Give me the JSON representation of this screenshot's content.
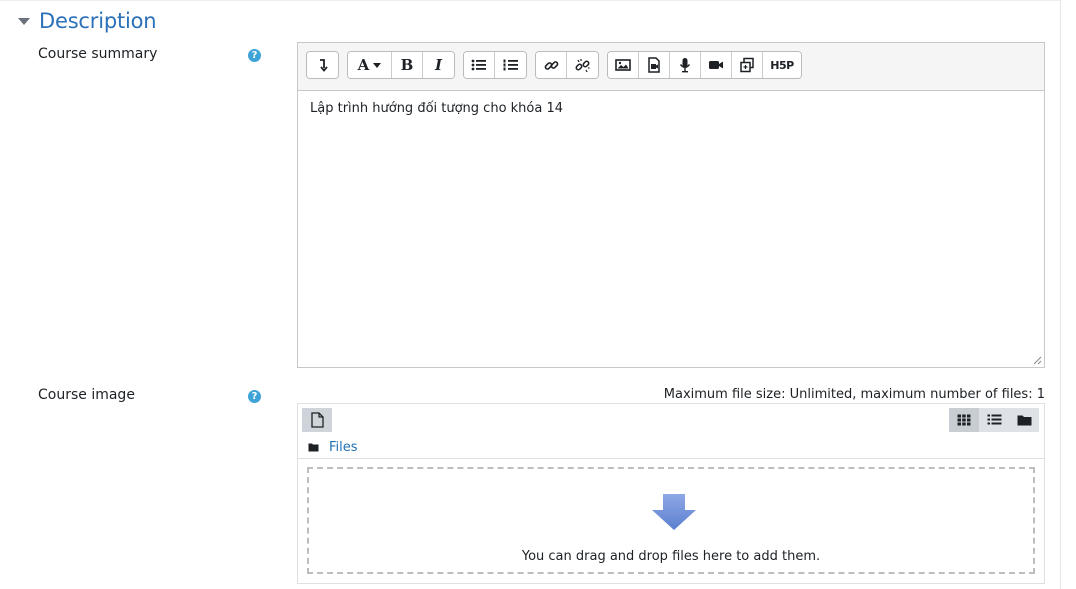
{
  "section": {
    "title": "Description",
    "collapse_icon": "caret-down-icon"
  },
  "summary": {
    "label": "Course summary",
    "help_icon": "question-circle-icon",
    "content": "Lập trình hướng đối tượng cho khóa 14",
    "toolbar": {
      "groups": [
        [
          "show-more-buttons"
        ],
        [
          "font-style",
          "bold",
          "italic"
        ],
        [
          "unordered-list",
          "ordered-list"
        ],
        [
          "link",
          "unlink"
        ],
        [
          "image",
          "media",
          "record-audio",
          "record-video",
          "manage-files",
          "h5p"
        ]
      ],
      "font_glyph": "A",
      "bold_glyph": "B",
      "italic_glyph": "I",
      "h5p_label": "H5P"
    }
  },
  "course_image": {
    "label": "Course image",
    "help_icon": "question-circle-icon",
    "max_size_text": "Maximum file size: Unlimited, maximum number of files: 1",
    "path_label": "Files",
    "drop_text": "You can drag and drop files here to add them.",
    "views": [
      "icons",
      "details",
      "tree"
    ],
    "active_view": "icons"
  },
  "colors": {
    "title": "#2b71b8",
    "help": "#3ea3d6",
    "link": "#1f6fb5",
    "arrow": "#6f8fd6"
  }
}
